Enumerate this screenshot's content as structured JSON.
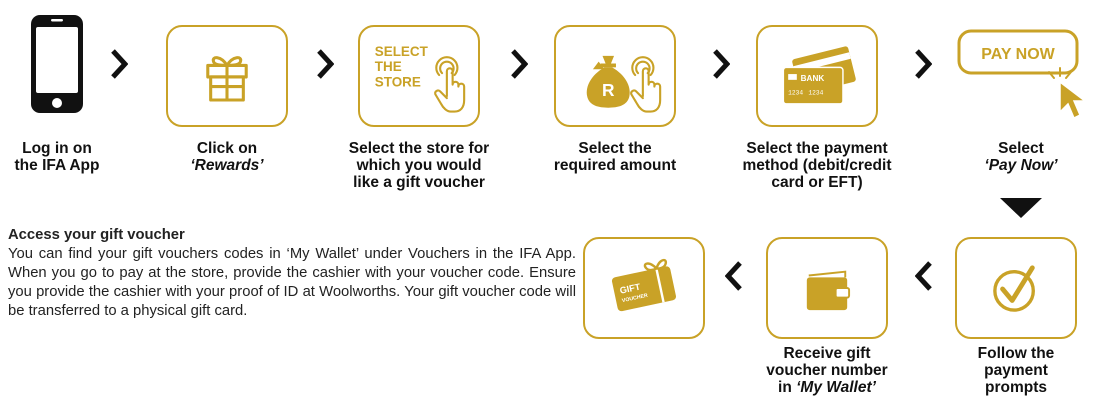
{
  "colors": {
    "gold": "#c9a227",
    "dark": "#111111"
  },
  "steps": [
    {
      "id": "login",
      "icon": "phone-icon",
      "line1": "Log in on",
      "line2": "the IFA App"
    },
    {
      "id": "rewards",
      "icon": "gift-icon",
      "line1": "Click on",
      "line2": "‘Rewards’"
    },
    {
      "id": "store",
      "icon": "tap-icon",
      "box_text_1": "SELECT",
      "box_text_2": "THE",
      "box_text_3": "STORE",
      "line1": "Select the store for",
      "line2": "which you would",
      "line3": "like a gift voucher"
    },
    {
      "id": "amount",
      "icon": "money-bag-icon",
      "box_text": "R",
      "line1": "Select the",
      "line2": "required amount"
    },
    {
      "id": "payment",
      "icon": "bank-card-icon",
      "box_text": "BANK",
      "card_digits_1": "1234",
      "card_digits_2": "1234",
      "line1": "Select the payment",
      "line2": "method (debit/credit",
      "line3": "card or EFT)"
    },
    {
      "id": "paynow",
      "icon": "cursor-icon",
      "box_text": "PAY NOW",
      "line1": "Select",
      "line2": "‘Pay Now’"
    },
    {
      "id": "prompts",
      "icon": "checkmark-icon",
      "line1": "Follow the",
      "line2": "payment",
      "line3": "prompts"
    },
    {
      "id": "wallet",
      "icon": "wallet-icon",
      "line1": "Receive gift",
      "line2": "voucher number",
      "line3_prefix": "in ",
      "line3_em": "‘My Wallet’"
    },
    {
      "id": "voucher",
      "icon": "gift-voucher-icon",
      "box_text_1": "GIFT",
      "box_text_2": "VOUCHER"
    }
  ],
  "access": {
    "heading": "Access your gift voucher",
    "body": "You can find your gift vouchers codes in ‘My Wallet’ under Vouchers in the IFA App. When you go to pay at the store, provide the cashier with your voucher code. Ensure you provide the cashier with your proof of ID at Woolworths. Your gift voucher code will be transferred to a physical gift card."
  }
}
